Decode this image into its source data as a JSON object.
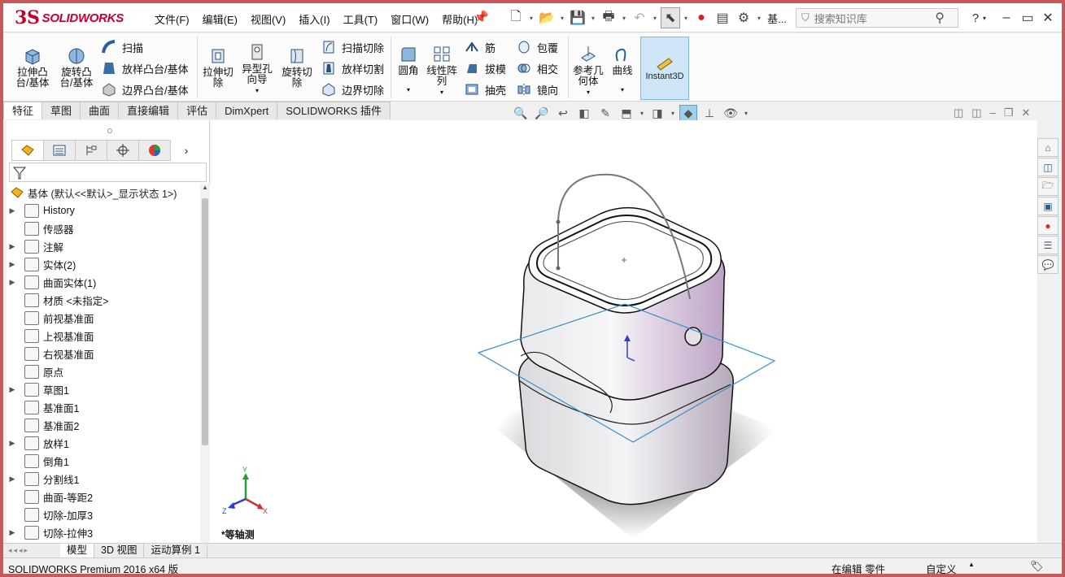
{
  "app": {
    "brand": "SOLIDWORKS",
    "brand_mark": "3S"
  },
  "menu": [
    "文件(F)",
    "编辑(E)",
    "视图(V)",
    "插入(I)",
    "工具(T)",
    "窗口(W)",
    "帮助(H)"
  ],
  "title_short": "基...",
  "search": {
    "placeholder": "搜索知识库"
  },
  "ribbon": {
    "extrude_boss": "拉伸凸\n台/基体",
    "revolve_boss": "旋转凸\n台/基体",
    "sweep": "扫描",
    "loft_boss": "放样凸台/基体",
    "boundary_boss": "边界凸台/基体",
    "extrude_cut": "拉伸切\n除",
    "hole_wizard": "异型孔\n向导",
    "revolve_cut": "旋转切\n除",
    "swept_cut": "扫描切除",
    "lofted_cut": "放样切割",
    "boundary_cut": "边界切除",
    "fillet": "圆角",
    "linear_pattern": "线性阵\n列",
    "rib": "筋",
    "draft": "拔模",
    "shell": "抽壳",
    "wrap": "包覆",
    "intersect": "相交",
    "mirror": "镜向",
    "ref_geometry": "参考几\n何体",
    "curves": "曲线",
    "instant3d": "Instant3D"
  },
  "tabs": [
    "特征",
    "草图",
    "曲面",
    "直接编辑",
    "评估",
    "DimXpert",
    "SOLIDWORKS 插件"
  ],
  "tree": {
    "root": "基体  (默认<<默认>_显示状态 1>)",
    "items": [
      {
        "label": "History",
        "exp": "▶"
      },
      {
        "label": "传感器",
        "exp": ""
      },
      {
        "label": "注解",
        "exp": "▶"
      },
      {
        "label": "实体(2)",
        "exp": "▶"
      },
      {
        "label": "曲面实体(1)",
        "exp": "▶"
      },
      {
        "label": "材质 <未指定>",
        "exp": ""
      },
      {
        "label": "前视基准面",
        "exp": ""
      },
      {
        "label": "上视基准面",
        "exp": ""
      },
      {
        "label": "右视基准面",
        "exp": ""
      },
      {
        "label": "原点",
        "exp": ""
      },
      {
        "label": "草图1",
        "exp": "▶"
      },
      {
        "label": "基准面1",
        "exp": ""
      },
      {
        "label": "基准面2",
        "exp": ""
      },
      {
        "label": "放样1",
        "exp": "▶"
      },
      {
        "label": "倒角1",
        "exp": ""
      },
      {
        "label": "分割线1",
        "exp": "▶"
      },
      {
        "label": "曲面-等距2",
        "exp": ""
      },
      {
        "label": "切除-加厚3",
        "exp": ""
      },
      {
        "label": "切除-拉伸3",
        "exp": "▶"
      }
    ]
  },
  "viewport": {
    "view_label": "*等轴测",
    "axis_x": "X",
    "axis_y": "Y",
    "axis_z": "Z"
  },
  "bottom_tabs": [
    "模型",
    "3D 视图",
    "运动算例 1"
  ],
  "status": {
    "product": "SOLIDWORKS Premium 2016 x64 版",
    "mode": "在编辑 零件",
    "units": "自定义"
  }
}
